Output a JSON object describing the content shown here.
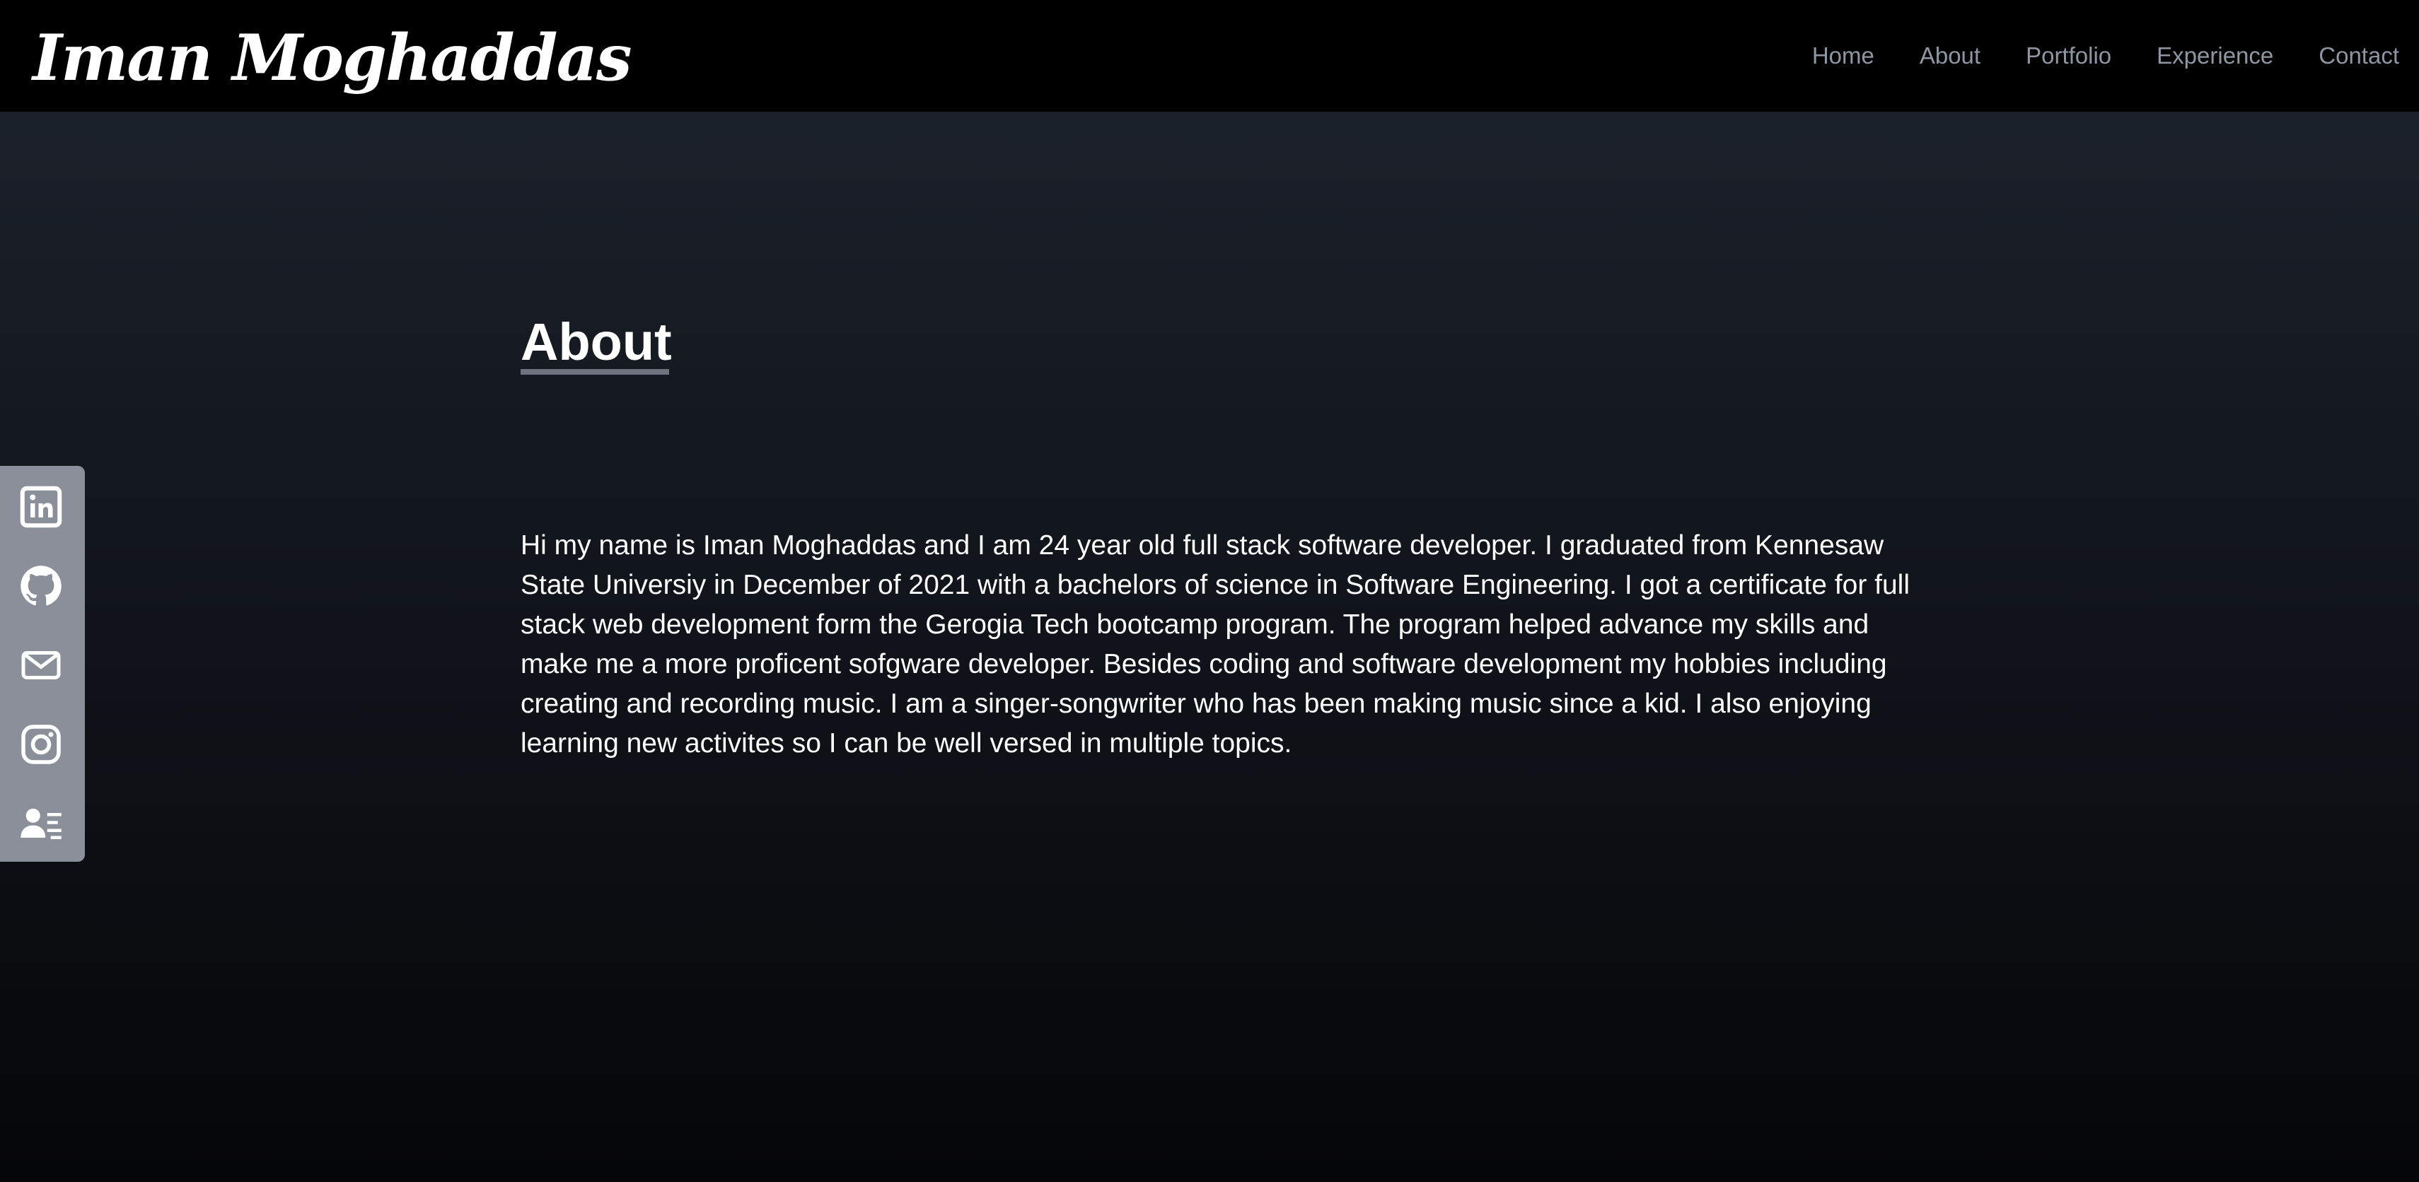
{
  "header": {
    "brand": "Iman Moghaddas",
    "nav": [
      {
        "label": "Home"
      },
      {
        "label": "About"
      },
      {
        "label": "Portfolio"
      },
      {
        "label": "Experience"
      },
      {
        "label": "Contact"
      }
    ]
  },
  "social": {
    "icons": [
      "linkedin-icon",
      "github-icon",
      "mail-icon",
      "instagram-icon",
      "resume-icon"
    ],
    "bar_color": "#8a8f99",
    "icon_color": "#ffffff"
  },
  "about": {
    "title": "About",
    "paragraph": "Hi my name is Iman Moghaddas and I am 24 year old full stack software developer. I graduated from Kennesaw State Universiy in December of 2021 with a bachelors of science in Software Engineering. I got a certificate for full stack web development form the Gerogia Tech bootcamp program. The program helped advance my skills and make me a more proficent sofgware developer. Besides coding and software development my hobbies including creating and recording music. I am a singer-songwriter who has been making music since a kid. I also enjoying learning new activites so I can be well versed in multiple topics."
  },
  "colors": {
    "nav_bg": "#000000",
    "nav_link": "#8f96a3",
    "text": "#ffffff",
    "title_underline": "#6e7380"
  }
}
